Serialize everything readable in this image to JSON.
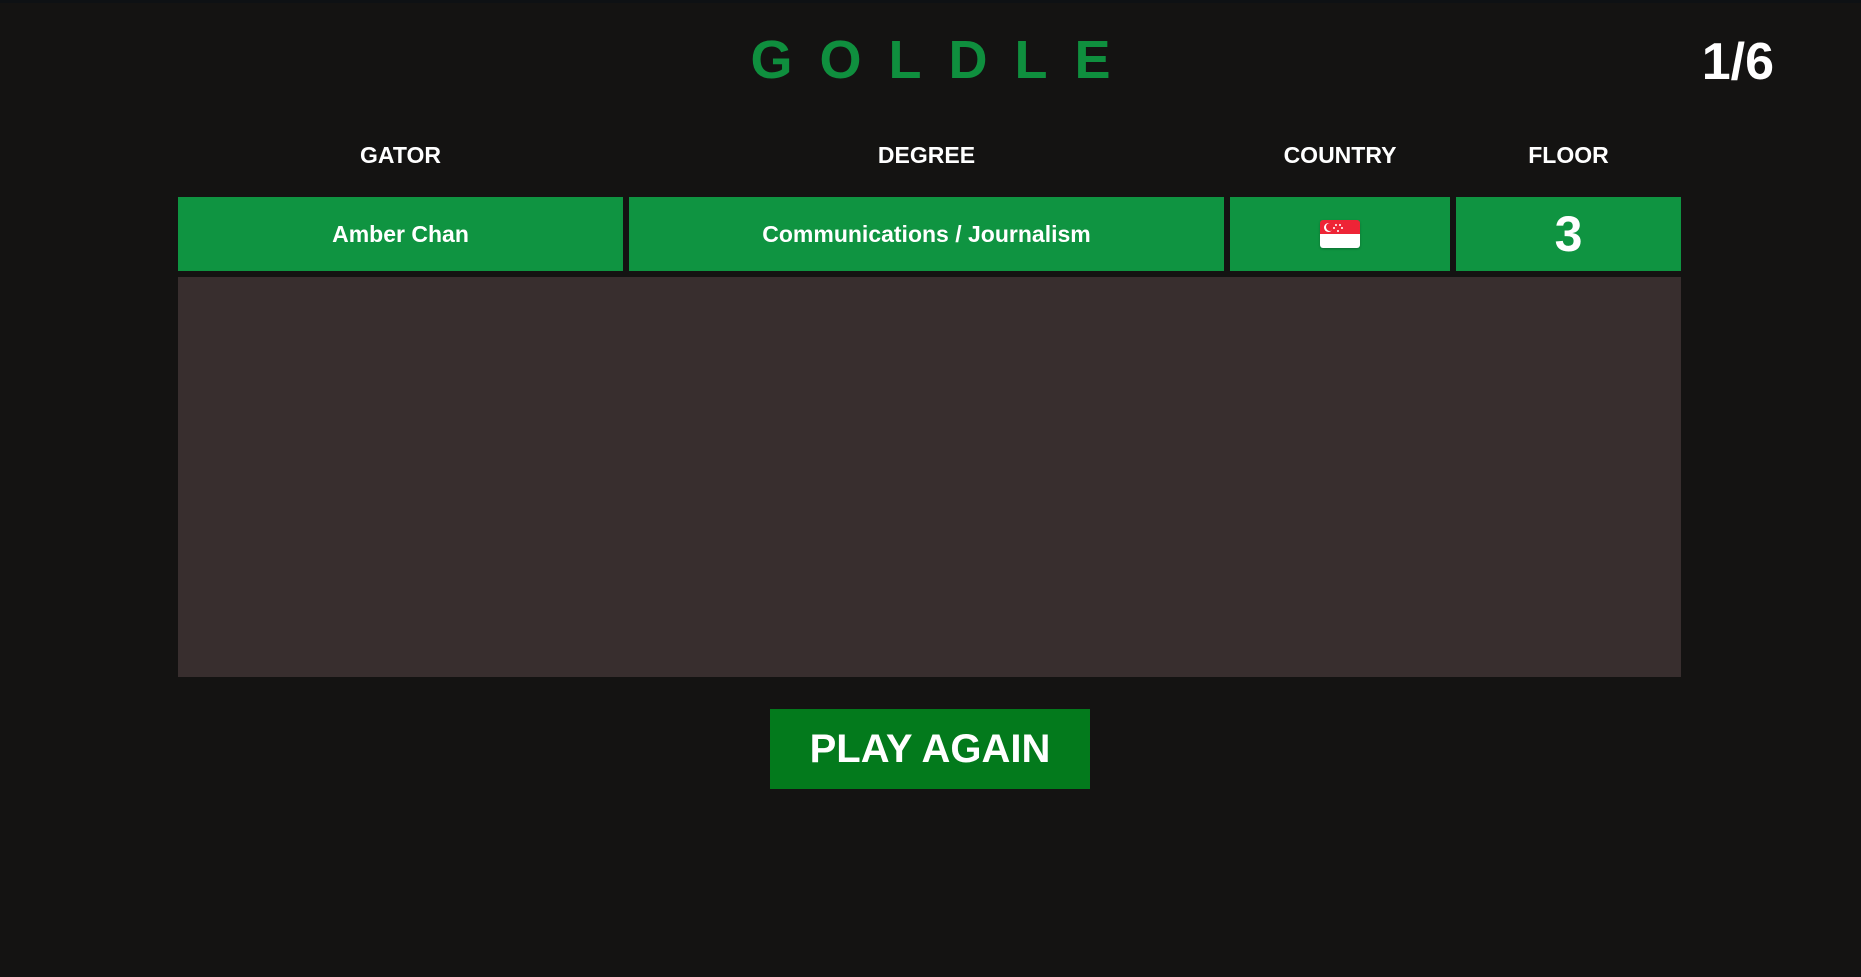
{
  "header": {
    "title": "GOLDLE",
    "guess_counter": "1/6"
  },
  "columns": [
    "GATOR",
    "DEGREE",
    "COUNTRY",
    "FLOOR"
  ],
  "guesses": [
    {
      "gator": "Amber Chan",
      "degree": "Communications / Journalism",
      "country_flag_icon": "singapore-flag-icon",
      "floor": "3",
      "status_color": "#0f9441"
    }
  ],
  "actions": {
    "play_again_label": "PLAY AGAIN"
  },
  "colors": {
    "background": "#141312",
    "title": "#0f8f3e",
    "correct": "#0f9441",
    "board": "#382e2e",
    "button": "#037a1c"
  }
}
